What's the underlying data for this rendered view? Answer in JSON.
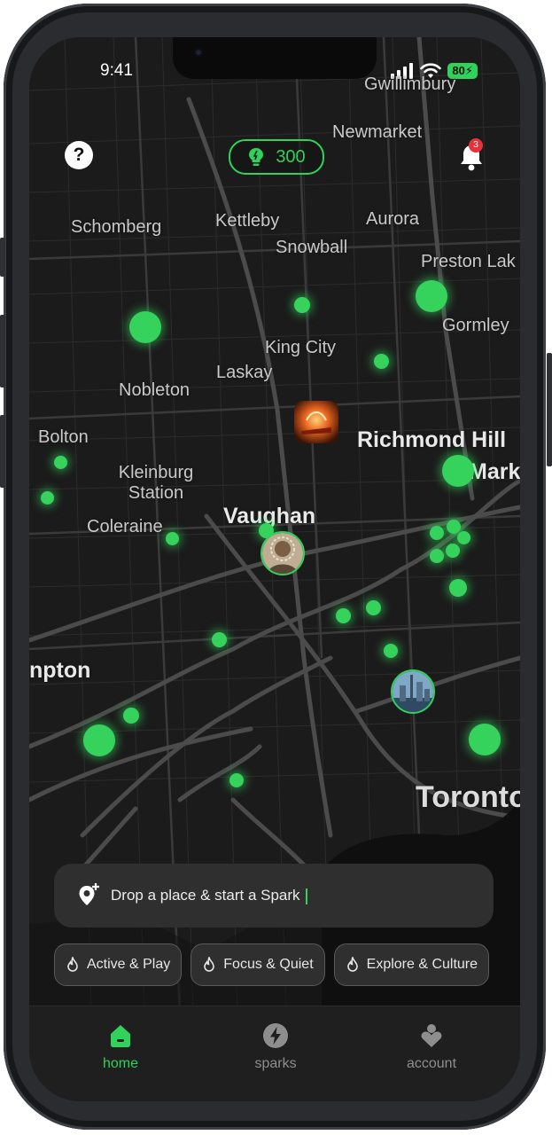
{
  "status_bar": {
    "time": "9:41",
    "battery": "80"
  },
  "header": {
    "help_icon": "?",
    "points": "300",
    "notification_count": "3"
  },
  "map_labels": {
    "gwillimbury": "Gwillimbury",
    "newmarket": "Newmarket",
    "schomberg": "Schomberg",
    "kettleby": "Kettleby",
    "aurora": "Aurora",
    "snowball": "Snowball",
    "preston_lake": "Preston Lak",
    "gormley": "Gormley",
    "king_city": "King City",
    "laskay": "Laskay",
    "nobleton": "Nobleton",
    "bolton": "Bolton",
    "richmond_hill": "Richmond Hill",
    "markham": "Mark",
    "kleinburg_station": "Kleinburg Station",
    "kleinburg_line1": "Kleinburg",
    "kleinburg_line2": "Station",
    "vaughan": "Vaughan",
    "coleraine": "Coleraine",
    "brampton": "npton",
    "toronto": "Toronto"
  },
  "search": {
    "placeholder": "Drop a place & start a Spark"
  },
  "chips": [
    {
      "label": "Active & Play",
      "icon": "flame-icon"
    },
    {
      "label": "Focus & Quiet",
      "icon": "flame-icon"
    },
    {
      "label": "Explore & Culture",
      "icon": "flame-icon"
    }
  ],
  "nav": {
    "home": "home",
    "sparks": "sparks",
    "account": "account"
  },
  "colors": {
    "accent": "#2fd25a",
    "map_bg": "#1b1b1b",
    "badge": "#e8323b"
  }
}
